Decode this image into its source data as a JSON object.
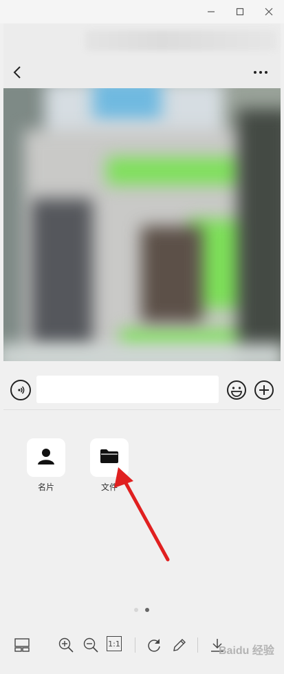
{
  "window": {
    "minimize_icon": "minimize-icon",
    "maximize_icon": "maximize-icon",
    "close_icon": "close-icon"
  },
  "chat": {
    "back_icon": "chevron-left-icon",
    "more_icon": "more-dots-icon"
  },
  "input": {
    "value": "",
    "voice_icon": "voice-icon",
    "emoji_icon": "emoji-icon",
    "plus_icon": "plus-icon"
  },
  "attachments": [
    {
      "label": "名片",
      "icon": "contact-card-icon"
    },
    {
      "label": "文件",
      "icon": "folder-icon"
    }
  ],
  "pager": {
    "total": 2,
    "active": 2
  },
  "toolbar": {
    "zoom_ratio_label": "1:1",
    "watermark": "Baidu 经验"
  },
  "colors": {
    "accent_green": "#95ec69",
    "arrow_red": "#e02020"
  }
}
